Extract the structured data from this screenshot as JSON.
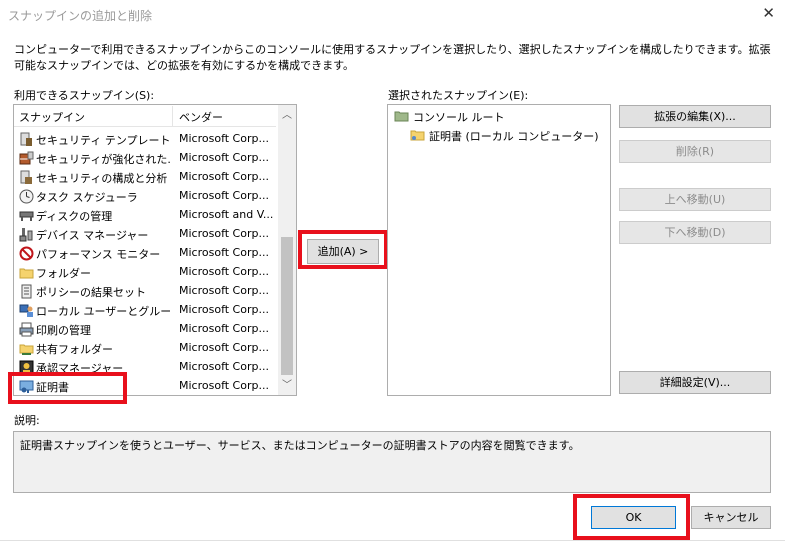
{
  "window": {
    "title": "スナップインの追加と削除",
    "close_glyph": "✕"
  },
  "description": "コンピューターで利用できるスナップインからこのコンソールに使用するスナップインを選択したり、選択したスナップインを構成したりできます。拡張可能なスナップインでは、どの拡張を有効にするかを構成できます。",
  "available": {
    "label": "利用できるスナップイン(S):",
    "col_snapin": "スナップイン",
    "col_vendor": "ベンダー",
    "rows": [
      {
        "name": "セキュリティ テンプレート",
        "vendor": "Microsoft Corp...",
        "icon": "security-template-icon"
      },
      {
        "name": "セキュリティが強化された...",
        "vendor": "Microsoft Corp...",
        "icon": "firewall-icon"
      },
      {
        "name": "セキュリティの構成と分析",
        "vendor": "Microsoft Corp...",
        "icon": "security-config-icon"
      },
      {
        "name": "タスク スケジューラ",
        "vendor": "Microsoft Corp...",
        "icon": "clock-icon"
      },
      {
        "name": "ディスクの管理",
        "vendor": "Microsoft and V...",
        "icon": "disk-icon"
      },
      {
        "name": "デバイス マネージャー",
        "vendor": "Microsoft Corp...",
        "icon": "device-manager-icon"
      },
      {
        "name": "パフォーマンス モニター",
        "vendor": "Microsoft Corp...",
        "icon": "perf-monitor-icon"
      },
      {
        "name": "フォルダー",
        "vendor": "Microsoft Corp...",
        "icon": "folder-icon"
      },
      {
        "name": "ポリシーの結果セット",
        "vendor": "Microsoft Corp...",
        "icon": "policy-icon"
      },
      {
        "name": "ローカル ユーザーとグループ",
        "vendor": "Microsoft Corp...",
        "icon": "users-icon"
      },
      {
        "name": "印刷の管理",
        "vendor": "Microsoft Corp...",
        "icon": "printer-icon"
      },
      {
        "name": "共有フォルダー",
        "vendor": "Microsoft Corp...",
        "icon": "shared-folder-icon"
      },
      {
        "name": "承認マネージャー",
        "vendor": "Microsoft Corp...",
        "icon": "authorization-icon"
      },
      {
        "name": "証明書",
        "vendor": "Microsoft Corp...",
        "icon": "certificate-icon"
      }
    ],
    "scroll_up": "︿",
    "scroll_down": "﹀"
  },
  "add_button": "追加(A) >",
  "selected": {
    "label": "選択されたスナップイン(E):",
    "root": "コンソール ルート",
    "child": "証明書 (ローカル コンピューター)"
  },
  "buttons": {
    "edit_ext": "拡張の編集(X)...",
    "remove": "削除(R)",
    "move_up": "上へ移動(U)",
    "move_down": "下へ移動(D)",
    "advanced": "詳細設定(V)...",
    "ok": "OK",
    "cancel": "キャンセル"
  },
  "explanation": {
    "label": "説明:",
    "text": "証明書スナップインを使うとユーザー、サービス、またはコンピューターの証明書ストアの内容を閲覧できます。"
  },
  "colors": {
    "highlight_red": "#e8101c",
    "button_face": "#e1e1e1",
    "focus_blue": "#0078d7"
  }
}
